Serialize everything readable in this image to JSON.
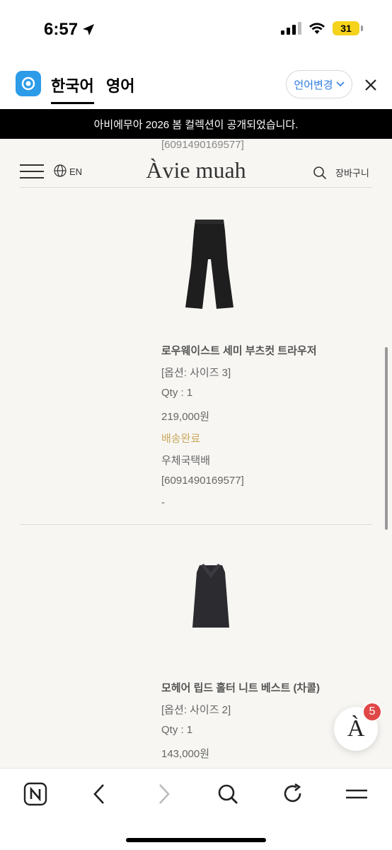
{
  "status": {
    "time": "6:57",
    "battery": "31"
  },
  "translate": {
    "tab_active": "한국어",
    "tab_inactive": "영어",
    "change_label": "언어변경"
  },
  "announcement": "아비에무아 2026 봄 컬렉션이 공개되었습니다.",
  "header": {
    "peek_text": "[6091490169577]",
    "lang": "EN",
    "logo": "Àvie muah",
    "cart": "장바구니"
  },
  "items": [
    {
      "name": "로우웨이스트 세미 부츠컷 트라우저",
      "option": "[옵션: 사이즈 3]",
      "qty": "Qty : 1",
      "price": "219,000원",
      "status": "배송완료",
      "courier": "우체국택배",
      "tracking": "[6091490169577]",
      "dash": "-"
    },
    {
      "name": "모헤어 립드 홀터 니트 베스트 (차콜)",
      "option": "[옵션: 사이즈 2]",
      "qty": "Qty : 1",
      "price": "143,000원"
    }
  ],
  "fab": {
    "label": "À",
    "badge": "5"
  },
  "colors": {
    "accent_link": "#2e7de0",
    "status_gold": "#c9a85c",
    "badge_red": "#e04848"
  }
}
